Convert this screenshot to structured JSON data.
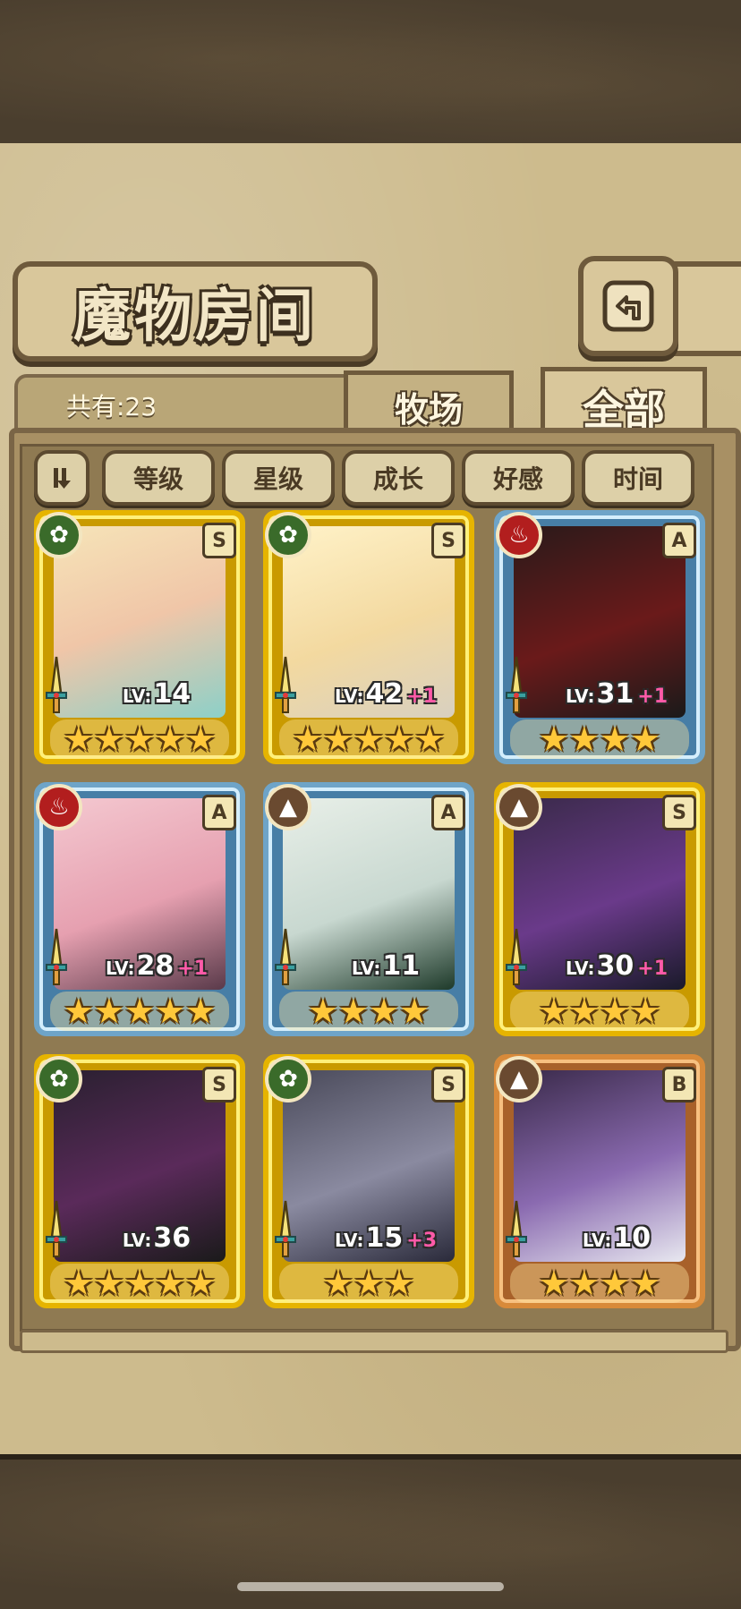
{
  "header": {
    "title": "魔物房间",
    "back_icon": "back-arrow-icon"
  },
  "collection": {
    "count_label": "共有:23"
  },
  "tabs": [
    {
      "label": "牧场",
      "active": false
    },
    {
      "label": "全部",
      "active": true
    }
  ],
  "sort": {
    "toggle_icon": "sort-order-icon",
    "buttons": [
      "等级",
      "星级",
      "成长",
      "好感",
      "时间"
    ]
  },
  "colors": {
    "gold_frame": "#e6b400",
    "blue_frame": "#6ea4c8",
    "bronze_frame": "#d88a3a",
    "wood_element": "#3a6b2a",
    "fire_element": "#b21e1e",
    "earth_element": "#6a4a30",
    "level_plus": "#ff5aa8"
  },
  "monsters": [
    {
      "element": "wood",
      "rarity": "S",
      "lv_prefix": "LV:",
      "level": "14",
      "plus": "",
      "stars": 5,
      "frame": "gold"
    },
    {
      "element": "wood",
      "rarity": "S",
      "lv_prefix": "LV:",
      "level": "42",
      "plus": "+1",
      "stars": 5,
      "frame": "gold"
    },
    {
      "element": "fire",
      "rarity": "A",
      "lv_prefix": "LV:",
      "level": "31",
      "plus": "+1",
      "stars": 4,
      "frame": "blue"
    },
    {
      "element": "fire",
      "rarity": "A",
      "lv_prefix": "LV:",
      "level": "28",
      "plus": "+1",
      "stars": 5,
      "frame": "blue"
    },
    {
      "element": "earth",
      "rarity": "A",
      "lv_prefix": "LV:",
      "level": "11",
      "plus": "",
      "stars": 4,
      "frame": "blue"
    },
    {
      "element": "earth",
      "rarity": "S",
      "lv_prefix": "LV:",
      "level": "30",
      "plus": "+1",
      "stars": 4,
      "frame": "gold"
    },
    {
      "element": "wood",
      "rarity": "S",
      "lv_prefix": "LV:",
      "level": "36",
      "plus": "",
      "stars": 5,
      "frame": "gold"
    },
    {
      "element": "wood",
      "rarity": "S",
      "lv_prefix": "LV:",
      "level": "15",
      "plus": "+3",
      "stars": 3,
      "frame": "gold"
    },
    {
      "element": "earth",
      "rarity": "B",
      "lv_prefix": "LV:",
      "level": "10",
      "plus": "",
      "stars": 4,
      "frame": "bronze"
    }
  ]
}
